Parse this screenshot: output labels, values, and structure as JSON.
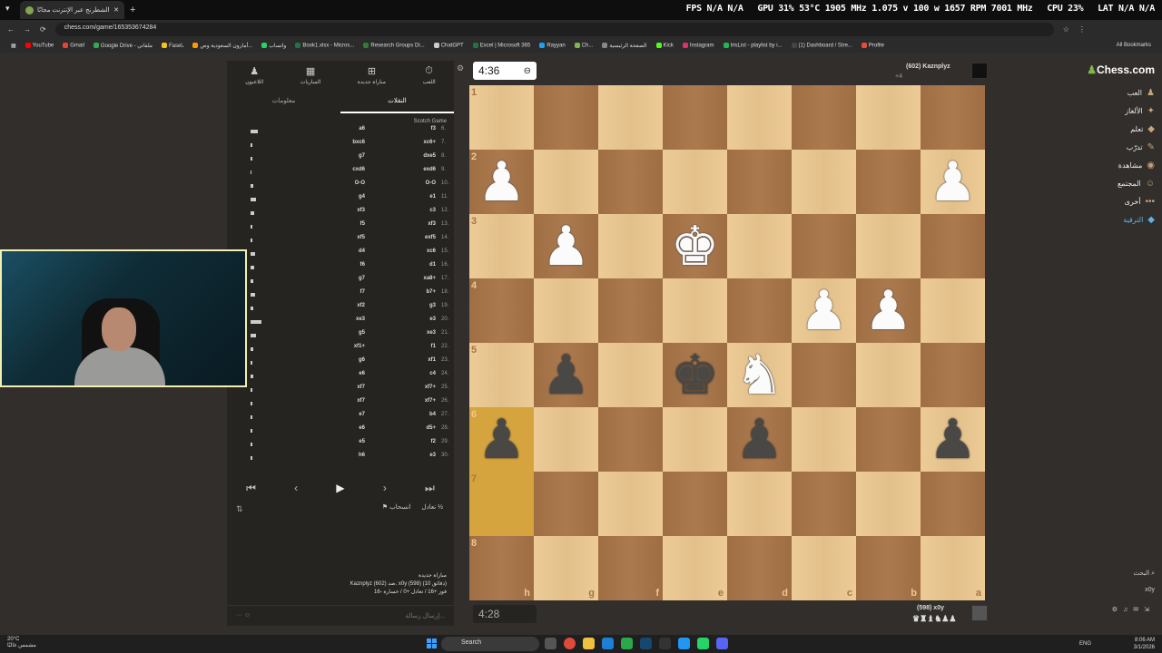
{
  "browser": {
    "tab_title": "إلعب الشطرنج عبر الإنترنت مجانًا",
    "url": "chess.com/game/165353674284",
    "bookmarks": [
      {
        "label": "YouTube",
        "color": "#ff0000"
      },
      {
        "label": "Gmail",
        "color": "#ea4335"
      },
      {
        "label": "Google Drive - ملفاتي",
        "color": "#34a853"
      },
      {
        "label": "Faselـ",
        "color": "#f5c518"
      },
      {
        "label": "أمازون السعودية وص...",
        "color": "#ff9900"
      },
      {
        "label": "واتساب",
        "color": "#25d366"
      },
      {
        "label": "Book1.xlsx - Micros...",
        "color": "#217346"
      },
      {
        "label": "Research Groups Di...",
        "color": "#2e7d32"
      },
      {
        "label": "ChatGPT",
        "color": "#cccccc"
      },
      {
        "label": "Excel | Microsoft 365",
        "color": "#217346"
      },
      {
        "label": "Rayyan",
        "color": "#1da1f2"
      },
      {
        "label": "Ch...",
        "color": "#81b64c"
      },
      {
        "label": "الصفحة الرئيسية",
        "color": "#888888"
      },
      {
        "label": "Kick",
        "color": "#53fc18"
      },
      {
        "label": "Instagram",
        "color": "#e1306c"
      },
      {
        "label": "IrisList - playlist by i...",
        "color": "#1db954"
      },
      {
        "label": "(1) Dashboard / Stre...",
        "color": "#444444"
      },
      {
        "label": "Profile",
        "color": "#e74c3c"
      }
    ],
    "all_bookmarks": "All Bookmarks"
  },
  "overlay_stats": {
    "fps": "FPS N/A N/A",
    "gpu": "GPU 31% 53°C 1905 MHz 1.075 v 100 w 1657 RPM 7001 MHz",
    "cpu": "CPU 23%",
    "lat": "LAT N/A N/A"
  },
  "panel": {
    "top_tabs": [
      {
        "label": "اللعب",
        "icon": "clock-icon"
      },
      {
        "label": "مباراة جديدة",
        "icon": "plus-icon"
      },
      {
        "label": "المباريات",
        "icon": "grid-icon"
      },
      {
        "label": "اللاعبون",
        "icon": "players-icon"
      }
    ],
    "sub_tabs": {
      "moves": "النقلات",
      "info": "معلومات"
    },
    "opening": "Scotch Game",
    "moves": [
      {
        "n": "6.",
        "w": "f3",
        "b": "a6",
        "tw": 8
      },
      {
        "n": "7.",
        "w": "xc6+",
        "b": "bxc6",
        "tw": 2
      },
      {
        "n": "8.",
        "w": "dxe5",
        "b": "g7",
        "tw": 2
      },
      {
        "n": "9.",
        "w": "exd6",
        "b": "cxd6",
        "tw": 1
      },
      {
        "n": "10.",
        "w": "O-O",
        "b": "O-O",
        "tw": 3
      },
      {
        "n": "11.",
        "w": "e1",
        "b": "g4",
        "tw": 6
      },
      {
        "n": "12.",
        "w": "c3",
        "b": "xf3",
        "tw": 4
      },
      {
        "n": "13.",
        "w": "xf3",
        "b": "f5",
        "tw": 2
      },
      {
        "n": "14.",
        "w": "exf5",
        "b": "xf5",
        "tw": 2
      },
      {
        "n": "15.",
        "w": "xc6",
        "b": "d4",
        "tw": 5
      },
      {
        "n": "16.",
        "w": "d1",
        "b": "f6",
        "tw": 4
      },
      {
        "n": "17.",
        "w": "xa8+",
        "b": "g7",
        "tw": 3
      },
      {
        "n": "18.",
        "w": "b7+",
        "b": "f7",
        "tw": 5
      },
      {
        "n": "19.",
        "w": "g3",
        "b": "xf2",
        "tw": 3
      },
      {
        "n": "20.",
        "w": "e3",
        "b": "xe3",
        "tw": 12
      },
      {
        "n": "21.",
        "w": "xe3",
        "b": "g5",
        "tw": 6
      },
      {
        "n": "22.",
        "w": "f1",
        "b": "xf1+",
        "tw": 3
      },
      {
        "n": "23.",
        "w": "xf1",
        "b": "g6",
        "tw": 2
      },
      {
        "n": "24.",
        "w": "c4",
        "b": "e6",
        "tw": 3
      },
      {
        "n": "25.",
        "w": "xf7+",
        "b": "xf7",
        "tw": 2
      },
      {
        "n": "26.",
        "w": "xf7+",
        "b": "xf7",
        "tw": 2
      },
      {
        "n": "27.",
        "w": "b4",
        "b": "e7",
        "tw": 2
      },
      {
        "n": "28.",
        "w": "d5+",
        "b": "e6",
        "tw": 2
      },
      {
        "n": "29.",
        "w": "f2",
        "b": "e5",
        "tw": 2
      },
      {
        "n": "30.",
        "w": "e3",
        "b": "h6",
        "tw": 2
      }
    ],
    "draw_label": "تعادل",
    "resign_label": "انسحاب",
    "game_info": {
      "line1": "مباراة جديدة",
      "line2": "Kaznplyz (602) ضد. x0y (598) (10 دقائق)",
      "line3": "فوز +16 / تعادل +0 / خسارة -16"
    },
    "chat_placeholder": "إرسال رسالة..."
  },
  "clocks": {
    "top": "4:36",
    "bottom": "4:28"
  },
  "players": {
    "top": {
      "name": "Kaznplyz",
      "rating": "(602)",
      "extra": "+4"
    },
    "bottom": {
      "name": "x0y",
      "rating": "(598)"
    }
  },
  "board": {
    "ranks": [
      "1",
      "2",
      "3",
      "4",
      "5",
      "6",
      "7",
      "8"
    ],
    "files": [
      "h",
      "g",
      "f",
      "e",
      "d",
      "c",
      "b",
      "a"
    ],
    "highlight": [
      [
        5,
        0
      ],
      [
        6,
        0
      ]
    ],
    "pieces": [
      {
        "r": 1,
        "c": 0,
        "p": "♟",
        "side": "w"
      },
      {
        "r": 1,
        "c": 7,
        "p": "♟",
        "side": "w"
      },
      {
        "r": 2,
        "c": 1,
        "p": "♟",
        "side": "w"
      },
      {
        "r": 2,
        "c": 3,
        "p": "♚",
        "side": "w"
      },
      {
        "r": 3,
        "c": 5,
        "p": "♟",
        "side": "w"
      },
      {
        "r": 3,
        "c": 6,
        "p": "♟",
        "side": "w"
      },
      {
        "r": 4,
        "c": 1,
        "p": "♟",
        "side": "b"
      },
      {
        "r": 4,
        "c": 3,
        "p": "♚",
        "side": "b"
      },
      {
        "r": 4,
        "c": 4,
        "p": "♞",
        "side": "w"
      },
      {
        "r": 5,
        "c": 0,
        "p": "♟",
        "side": "b"
      },
      {
        "r": 5,
        "c": 4,
        "p": "♟",
        "side": "b"
      },
      {
        "r": 5,
        "c": 7,
        "p": "♟",
        "side": "b"
      }
    ]
  },
  "right_nav": {
    "logo": "Chess.com",
    "items": [
      {
        "label": "العب",
        "icon": "play-icon"
      },
      {
        "label": "الألغاز",
        "icon": "puzzle-icon"
      },
      {
        "label": "تعلم",
        "icon": "learn-icon"
      },
      {
        "label": "تدرّب",
        "icon": "train-icon"
      },
      {
        "label": "مشاهدة",
        "icon": "watch-icon"
      },
      {
        "label": "المجتمع",
        "icon": "community-icon"
      },
      {
        "label": "أخرى",
        "icon": "more-icon"
      },
      {
        "label": "الترقية",
        "icon": "diamond-icon"
      }
    ],
    "search": "البحث",
    "username": "x0y"
  },
  "taskbar": {
    "weather_temp": "20°C",
    "weather_desc": "مشمس غالبًا",
    "search": "Search",
    "lang": "ENG",
    "time": "8:06 AM",
    "date": "3/1/2026"
  }
}
